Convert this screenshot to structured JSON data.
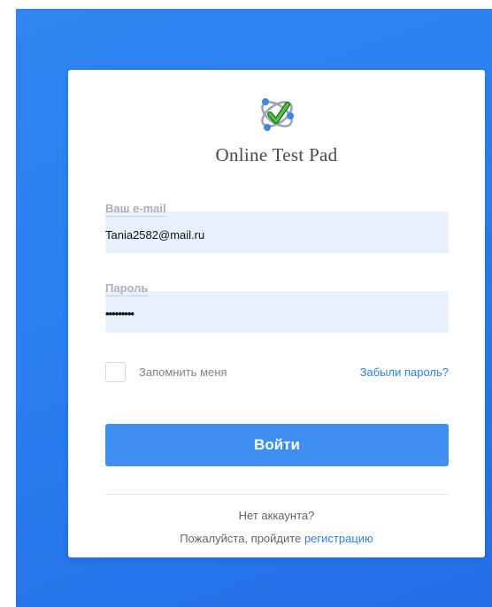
{
  "brand": {
    "logo_icon": "test-pad-logo-icon",
    "title": "Online Test Pad"
  },
  "form": {
    "email": {
      "label": "Ваш e-mail",
      "value": "Tania2582@mail.ru"
    },
    "password": {
      "label": "Пароль",
      "value": "•••••••••"
    },
    "remember_label": "Запомнить меня",
    "forgot_label": "Забыли пароль?",
    "submit_label": "Войти"
  },
  "footer": {
    "no_account": "Нет аккаунта?",
    "register_prefix": "Пожалуйста, пройдите",
    "register_link": "регистрацию"
  },
  "colors": {
    "background": "#2a7ff0",
    "button": "#3f8ef2",
    "link": "#2f7fe3",
    "input_bg": "#e8f0fe"
  }
}
